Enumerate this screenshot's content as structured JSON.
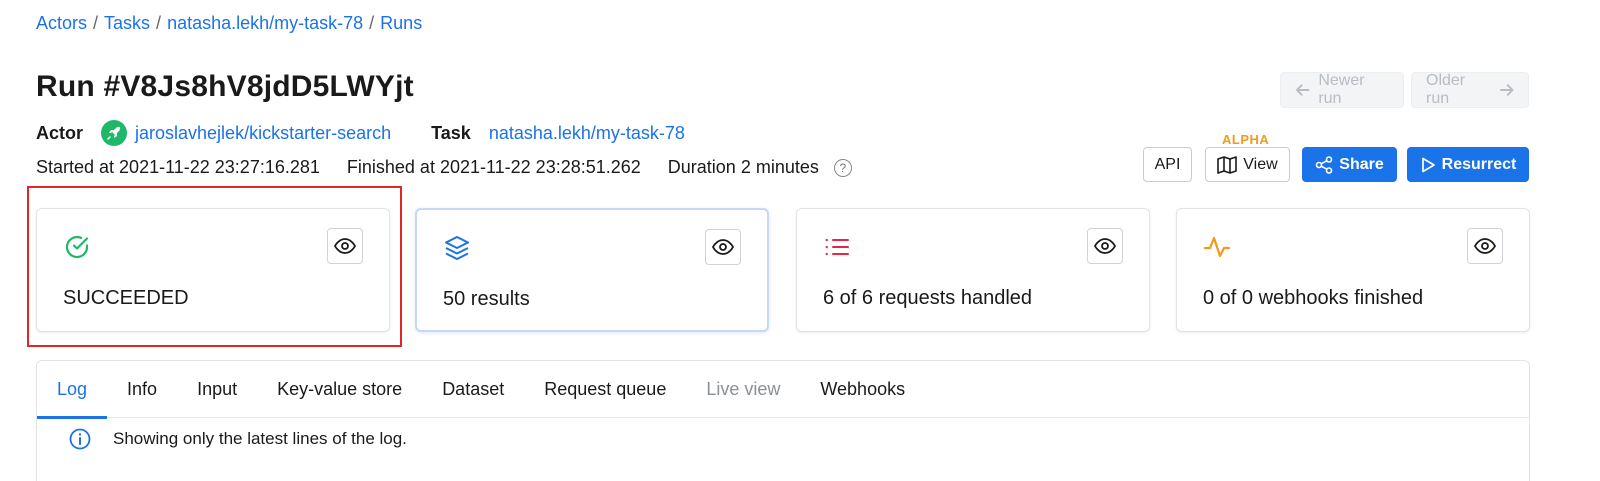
{
  "breadcrumb": {
    "items": [
      "Actors",
      "Tasks",
      "natasha.lekh/my-task-78",
      "Runs"
    ],
    "separator": "/"
  },
  "run": {
    "title": "Run #V8Js8hV8jdD5LWYjt",
    "actor_label": "Actor",
    "actor_name": "jaroslavhejlek/kickstarter-search",
    "task_label": "Task",
    "task_name": "natasha.lekh/my-task-78",
    "started": "Started at 2021-11-22 23:27:16.281",
    "finished": "Finished at 2021-11-22 23:28:51.262",
    "duration": "Duration 2 minutes",
    "help_glyph": "?"
  },
  "navigation": {
    "newer_label": "Newer run",
    "older_label": "Older run"
  },
  "actions": {
    "alpha_badge": "ALPHA",
    "api_label": "API",
    "view_label": "View",
    "share_label": "Share",
    "resurrect_label": "Resurrect"
  },
  "cards": [
    {
      "icon": "check-circle-icon",
      "color": "#1fb86a",
      "text": "SUCCEEDED"
    },
    {
      "icon": "layers-icon",
      "color": "#1a73e8",
      "text": "50 results"
    },
    {
      "icon": "list-icon",
      "color": "#e3264a",
      "text": "6 of 6 requests handled"
    },
    {
      "icon": "activity-icon",
      "color": "#f29a1a",
      "text": "0 of 0 webhooks finished"
    }
  ],
  "tabs": [
    {
      "label": "Log",
      "state": "active"
    },
    {
      "label": "Info",
      "state": "normal"
    },
    {
      "label": "Input",
      "state": "normal"
    },
    {
      "label": "Key-value store",
      "state": "normal"
    },
    {
      "label": "Dataset",
      "state": "normal"
    },
    {
      "label": "Request queue",
      "state": "normal"
    },
    {
      "label": "Live view",
      "state": "disabled"
    },
    {
      "label": "Webhooks",
      "state": "normal"
    }
  ],
  "log_notice": "Showing only the latest lines of the log.",
  "colors": {
    "accent": "#1a73e8",
    "highlight": "#e32626",
    "alpha": "#f29a1a"
  }
}
